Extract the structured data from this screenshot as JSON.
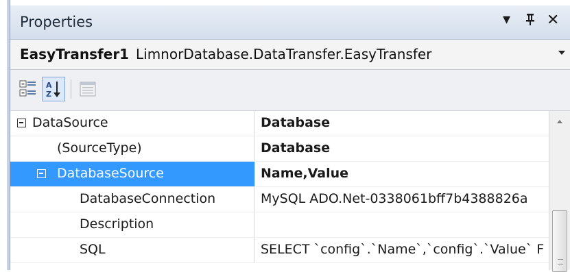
{
  "panel": {
    "title": "Properties"
  },
  "object": {
    "name": "EasyTransfer1",
    "type": "LimnorDatabase.DataTransfer.EasyTransfer"
  },
  "toolbar": {
    "sort_glyph_letters": "A Z"
  },
  "grid": {
    "rows": [
      {
        "name": "DataSource",
        "value": "Database",
        "value_bold": true,
        "expander": true,
        "indent": 0,
        "selected": false
      },
      {
        "name": "(SourceType)",
        "value": "Database",
        "value_bold": true,
        "expander": false,
        "indent": 1,
        "selected": false
      },
      {
        "name": "DatabaseSource",
        "value": "Name,Value",
        "value_bold": true,
        "expander": true,
        "indent": 1,
        "selected": true
      },
      {
        "name": "DatabaseConnection",
        "value": "MySQL ADO.Net-0338061bff7b4388826a",
        "value_bold": false,
        "expander": false,
        "indent": 2,
        "selected": false
      },
      {
        "name": "Description",
        "value": "",
        "value_bold": false,
        "expander": false,
        "indent": 2,
        "selected": false
      },
      {
        "name": "SQL",
        "value": "SELECT `config`.`Name`,`config`.`Value` F",
        "value_bold": false,
        "expander": false,
        "indent": 2,
        "selected": false
      }
    ]
  },
  "colors": {
    "selection": "#3399ff",
    "title_bar": "#dce4f0"
  }
}
